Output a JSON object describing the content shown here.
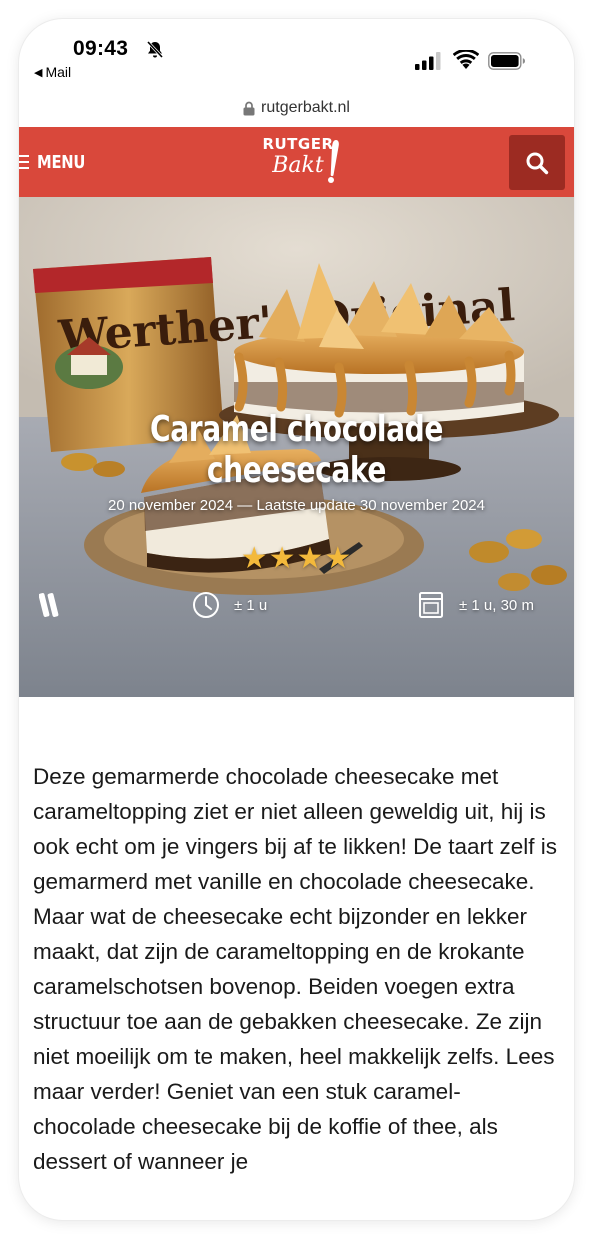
{
  "status_bar": {
    "time": "09:43",
    "back_label": "Mail"
  },
  "browser": {
    "url": "rutgerbakt.nl"
  },
  "header": {
    "menu_label": "MENU",
    "logo_top": "RUTGER",
    "logo_bottom": "Bakt",
    "accent_color": "#d9483b",
    "search_button_color": "#9c2b22"
  },
  "hero": {
    "title": "Caramel chocolade cheesecake",
    "dates": "20 november 2024 — Laatste update 30 november 2024",
    "package_text": "Werther's Original",
    "rating": 4,
    "rating_stars": "★★★★",
    "prep_time": "± 1 u",
    "bake_time": "± 1 u, 30 m",
    "icons": [
      "rolling-pins-icon",
      "clock-icon",
      "oven-icon"
    ]
  },
  "article": {
    "intro": "Deze gemarmerde chocolade cheesecake met carameltopping ziet er niet alleen geweldig uit, hij is ook echt om je vingers bij af te likken! De taart zelf is gemarmerd met vanille en chocolade cheesecake. Maar wat de cheesecake echt bijzonder en lekker maakt, dat zijn de carameltopping en de krokante caramelschotsen bovenop. Beiden voegen extra structuur toe aan de gebakken cheesecake. Ze zijn niet moeilijk om te maken, heel makkelijk zelfs. Lees maar verder! Geniet van een stuk caramel-chocolade cheesecake bij de koffie of thee, als dessert of wanneer je"
  }
}
